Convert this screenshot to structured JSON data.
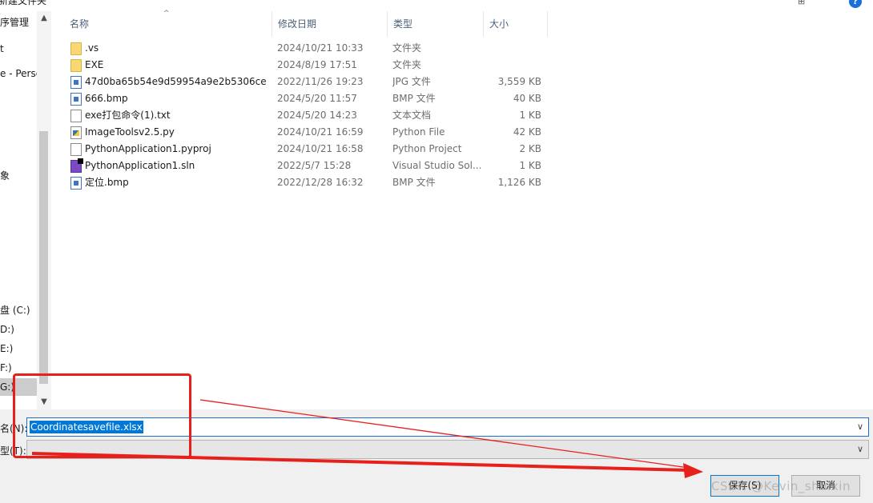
{
  "window": {
    "title_fragment": "新建文件夹",
    "view_menu": "⊞",
    "help": "?"
  },
  "nav": {
    "items": [
      {
        "label": "序管理"
      },
      {
        "label": "t"
      },
      {
        "label": "e - Perso"
      },
      {
        "label": "象"
      },
      {
        "label": "盘 (C:)"
      },
      {
        "label": "D:)"
      },
      {
        "label": "E:)"
      },
      {
        "label": "F:)"
      },
      {
        "label": "G:)"
      }
    ],
    "scroll_up": "▲",
    "scroll_down": "▼"
  },
  "list": {
    "columns": [
      "名称",
      "修改日期",
      "类型",
      "大小"
    ],
    "sort_indicator": "^",
    "files": [
      {
        "name": ".vs",
        "date": "2024/10/21 10:33",
        "type": "文件夹",
        "size": "",
        "icon": "folder-icon"
      },
      {
        "name": "EXE",
        "date": "2024/8/19 17:51",
        "type": "文件夹",
        "size": "",
        "icon": "folder-icon"
      },
      {
        "name": "47d0ba65b54e9d59954a9e2b5306ce...",
        "date": "2022/11/26 19:23",
        "type": "JPG 文件",
        "size": "3,559 KB",
        "icon": "image-file-icon"
      },
      {
        "name": "666.bmp",
        "date": "2024/5/20 11:57",
        "type": "BMP 文件",
        "size": "40 KB",
        "icon": "image-file-icon"
      },
      {
        "name": "exe打包命令(1).txt",
        "date": "2024/5/20 14:23",
        "type": "文本文档",
        "size": "1 KB",
        "icon": "text-file-icon"
      },
      {
        "name": "ImageToolsv2.5.py",
        "date": "2024/10/21 16:59",
        "type": "Python File",
        "size": "42 KB",
        "icon": "python-file-icon"
      },
      {
        "name": "PythonApplication1.pyproj",
        "date": "2024/10/21 16:58",
        "type": "Python Project",
        "size": "2 KB",
        "icon": "blank-file-icon"
      },
      {
        "name": "PythonApplication1.sln",
        "date": "2022/5/7 15:28",
        "type": "Visual Studio Sol...",
        "size": "1 KB",
        "icon": "visual-studio-icon"
      },
      {
        "name": "定位.bmp",
        "date": "2022/12/28 16:32",
        "type": "BMP 文件",
        "size": "1,126 KB",
        "icon": "image-file-icon"
      }
    ]
  },
  "filename": {
    "label": "名(N):",
    "value": "Coordinatesavefile.xlsx",
    "dropdown": "∨"
  },
  "filetype": {
    "label": "型(T):",
    "value": "",
    "dropdown": "∨"
  },
  "buttons": {
    "save": "保存(S)",
    "cancel": "取消"
  },
  "watermark": "CSDN @Kevin_shuixin",
  "annotation_color": "#e8201c"
}
